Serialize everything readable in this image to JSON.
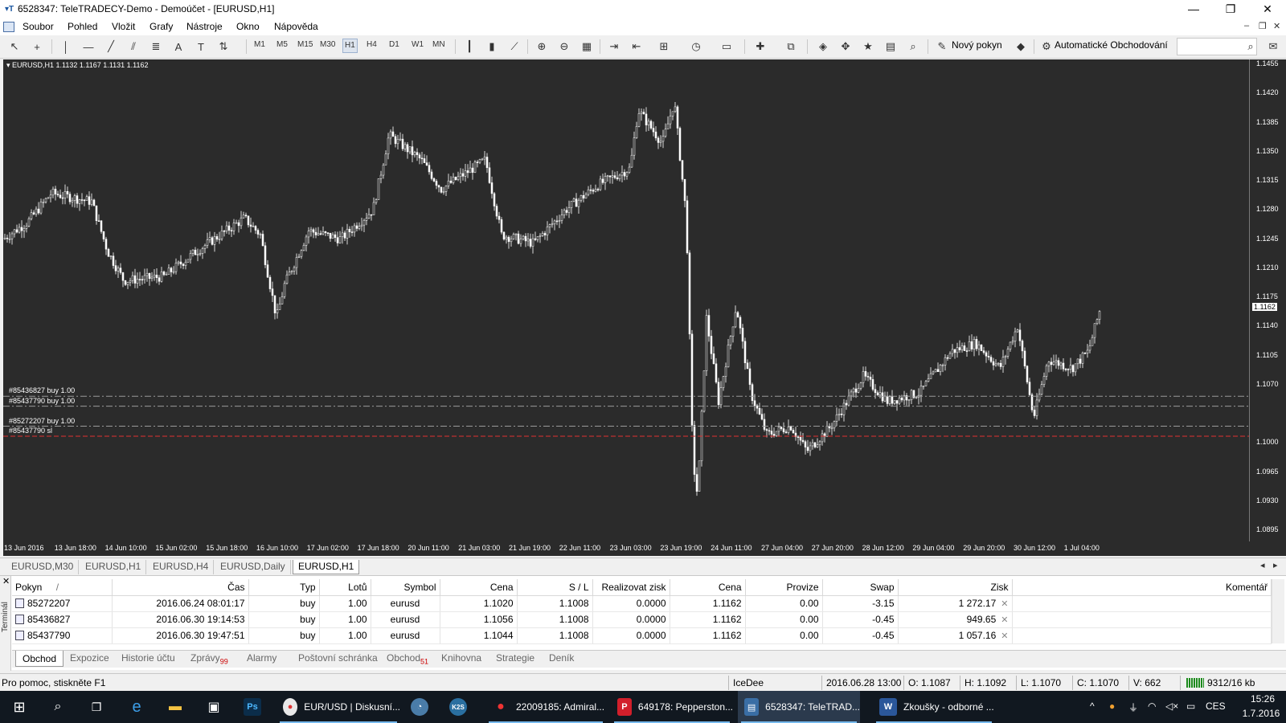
{
  "window": {
    "title": "6528347: TeleTRADECY-Demo - Demoúčet - [EURUSD,H1]",
    "minimize": "—",
    "maximize": "❐",
    "close": "✕"
  },
  "menu": [
    "Soubor",
    "Pohled",
    "Vložit",
    "Grafy",
    "Nástroje",
    "Okno",
    "Nápověda"
  ],
  "mdi_controls": [
    "–",
    "❐",
    "✕"
  ],
  "toolbar": {
    "timeframes": [
      "M1",
      "M5",
      "M15",
      "M30",
      "H1",
      "H4",
      "D1",
      "W1",
      "MN"
    ],
    "active_timeframe": "H1",
    "new_order": "Nový pokyn",
    "auto_trading": "Automatické Obchodování"
  },
  "chart": {
    "info": "▾ EURUSD,H1  1.1132 1.1167 1.1131 1.1162",
    "current_price": "1.1162",
    "y_labels": [
      "1.1455",
      "1.1420",
      "1.1385",
      "1.1350",
      "1.1315",
      "1.1280",
      "1.1245",
      "1.1210",
      "1.1175",
      "1.1140",
      "1.1105",
      "1.1070",
      "1.1000",
      "1.0965",
      "1.0930",
      "1.0895"
    ],
    "x_labels": [
      "13 Jun 2016",
      "13 Jun 18:00",
      "14 Jun 10:00",
      "15 Jun 02:00",
      "15 Jun 18:00",
      "16 Jun 10:00",
      "17 Jun 02:00",
      "17 Jun 18:00",
      "20 Jun 11:00",
      "21 Jun 03:00",
      "21 Jun 19:00",
      "22 Jun 11:00",
      "23 Jun 03:00",
      "23 Jun 19:00",
      "24 Jun 11:00",
      "27 Jun 04:00",
      "27 Jun 20:00",
      "28 Jun 12:00",
      "29 Jun 04:00",
      "29 Jun 20:00",
      "30 Jun 12:00",
      "1 Jul 04:00"
    ],
    "order_lines": [
      {
        "label": "#85436827 buy 1.00",
        "price": 1.1056
      },
      {
        "label": "#85437790 buy 1.00",
        "price": 1.1044
      },
      {
        "label": "#85272207 buy 1.00",
        "price": 1.102
      },
      {
        "label": "#85437790 sl",
        "price": 1.1008
      }
    ]
  },
  "chart_tabs": [
    "EURUSD,M30",
    "EURUSD,H1",
    "EURUSD,H4",
    "EURUSD,Daily",
    "EURUSD,H1"
  ],
  "active_chart_tab": 4,
  "terminal": {
    "side_label": "Terminál",
    "columns": [
      "Pokyn",
      "Čas",
      "Typ",
      "Lotů",
      "Symbol",
      "Cena",
      "S / L",
      "Realizovat zisk",
      "Cena",
      "Provize",
      "Swap",
      "Zisk",
      "Komentář"
    ],
    "sort_mark": "/",
    "rows": [
      [
        "85272207",
        "2016.06.24 08:01:17",
        "buy",
        "1.00",
        "eurusd",
        "1.1020",
        "1.1008",
        "0.0000",
        "1.1162",
        "0.00",
        "-3.15",
        "1 272.17",
        ""
      ],
      [
        "85436827",
        "2016.06.30 19:14:53",
        "buy",
        "1.00",
        "eurusd",
        "1.1056",
        "1.1008",
        "0.0000",
        "1.1162",
        "0.00",
        "-0.45",
        "949.65",
        ""
      ],
      [
        "85437790",
        "2016.06.30 19:47:51",
        "buy",
        "1.00",
        "eurusd",
        "1.1044",
        "1.1008",
        "0.0000",
        "1.1162",
        "0.00",
        "-0.45",
        "1 057.16",
        ""
      ]
    ],
    "tabs": [
      {
        "label": "Obchod",
        "badge": ""
      },
      {
        "label": "Expozice",
        "badge": ""
      },
      {
        "label": "Historie účtu",
        "badge": ""
      },
      {
        "label": "Zprávy",
        "badge": "99"
      },
      {
        "label": "Alarmy",
        "badge": ""
      },
      {
        "label": "Poštovní schránka",
        "badge": ""
      },
      {
        "label": "Obchod",
        "badge": "51"
      },
      {
        "label": "Knihovna",
        "badge": ""
      },
      {
        "label": "Strategie",
        "badge": ""
      },
      {
        "label": "Deník",
        "badge": ""
      }
    ]
  },
  "status": {
    "help": "Pro pomoc, stiskněte F1",
    "profile": "IceDee",
    "datetime": "2016.06.28 13:00",
    "open": "O: 1.1087",
    "high": "H: 1.1092",
    "low": "L: 1.1070",
    "close": "C: 1.1070",
    "volume": "V: 662",
    "traffic": "9312/16 kb"
  },
  "taskbar": {
    "items": [
      {
        "label": "EUR/USD | Diskusní...",
        "icon": "chrome-icon"
      },
      {
        "label": "22009185: Admiral...",
        "icon": "mt4-icon"
      },
      {
        "label": "649178: Pepperston...",
        "icon": "pepperstone-icon"
      },
      {
        "label": "6528347: TeleTRAD...",
        "icon": "mt4-icon"
      },
      {
        "label": "Zkoušky - odborné ...",
        "icon": "word-icon"
      }
    ],
    "lang": "CES",
    "time": "15:26",
    "date": "1.7.2016"
  }
}
